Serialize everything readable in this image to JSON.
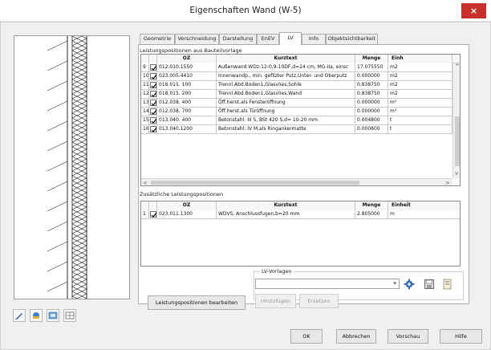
{
  "window": {
    "title": "Eigenschaften Wand (W-5)",
    "close_glyph": "×"
  },
  "tabs": [
    {
      "label": "Geometrie"
    },
    {
      "label": "Verschneidung"
    },
    {
      "label": "Darstellung"
    },
    {
      "label": "EnEV"
    },
    {
      "label": "LV",
      "active": true
    },
    {
      "label": "Info"
    },
    {
      "label": "Objektsichtbarkeit"
    }
  ],
  "positions": {
    "section_label": "Leistungspositionen aus Bauteilvorlage",
    "columns": [
      "",
      "",
      "OZ",
      "Kurztext",
      "Menge",
      "Einh"
    ],
    "rows": [
      {
        "num": "9",
        "checked": true,
        "oz": "012.010.1550",
        "kurztext": "Außenwand WDz-12-0,9-10DF,d=24 cm, MG-IIa, einsc",
        "menge": "17.075550",
        "einh": "m2"
      },
      {
        "num": "10",
        "checked": true,
        "oz": "023.005.4410",
        "kurztext": "Innenwandp., min. gefilzter Putz,Unter- und Oberputz",
        "menge": "0.000000",
        "einh": "m2"
      },
      {
        "num": "11",
        "checked": true,
        "oz": "018.015. 100",
        "kurztext": "Trennl.Abd.Boden1,Glasvlies,Sohle",
        "menge": "0.838750",
        "einh": "m2"
      },
      {
        "num": "12",
        "checked": true,
        "oz": "018.015. 200",
        "kurztext": "Trennl.Abd.Boden1,Glasvlies,Wand",
        "menge": "0.838750",
        "einh": "m2"
      },
      {
        "num": "13",
        "checked": true,
        "oz": "012.038. 400",
        "kurztext": "Öff.herst.als Fensteröffnung",
        "menge": "0.000000",
        "einh": "m²"
      },
      {
        "num": "14",
        "checked": true,
        "oz": "012.038. 700",
        "kurztext": "Öff.herst.als Türöffnung",
        "menge": "0.000000",
        "einh": "m²"
      },
      {
        "num": "15",
        "checked": true,
        "oz": "013.040. 400",
        "kurztext": "Betonstahl: III S, BSt 420 S,d= 10-20 mm",
        "menge": "0.004800",
        "einh": "t"
      },
      {
        "num": "16",
        "checked": true,
        "oz": "013.040.1200",
        "kurztext": "Betonstahl: IV M,als Ringankermatte",
        "menge": "0.000800",
        "einh": "t"
      }
    ]
  },
  "additional": {
    "section_label": "Zusätzliche Leistungspositionen",
    "columns": [
      "",
      "",
      "OZ",
      "Kurztext",
      "Menge",
      "Einheit"
    ],
    "rows": [
      {
        "num": "1",
        "checked": true,
        "oz": "023.011.1300",
        "kurztext": "WDVS, Anschlussfugen,b=20 mm",
        "menge": "2.805000",
        "einh": "m"
      }
    ]
  },
  "edit_button": "Leistungspositionen bearbeiten",
  "lv_vorlagen": {
    "group_label": "LV-Vorlagen",
    "combo_value": "",
    "add_button": "Hinzufügen",
    "replace_button": "Ersetzen"
  },
  "footer": {
    "ok": "OK",
    "cancel": "Abbrechen",
    "preview": "Vorschau",
    "help": "Hilfe"
  },
  "icons": {
    "left_toolbar": [
      "edit-pen-icon",
      "material-icon",
      "layers-icon",
      "grid-icon"
    ],
    "lv": [
      "settings-gear-icon",
      "save-icon",
      "open-icon"
    ]
  },
  "colors": {
    "close": "#c9302c",
    "background": "#f0f0f0",
    "panel": "#ffffff"
  }
}
